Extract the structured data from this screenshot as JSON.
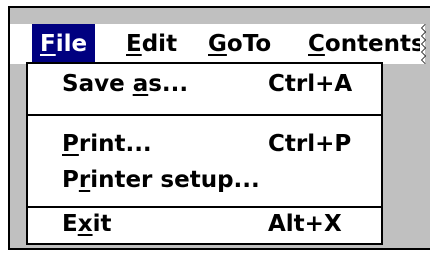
{
  "menubar": {
    "items": [
      {
        "pre": "",
        "accel": "F",
        "post": "ile",
        "active": true
      },
      {
        "pre": "",
        "accel": "E",
        "post": "dit",
        "active": false
      },
      {
        "pre": "",
        "accel": "G",
        "post": "oTo",
        "active": false
      },
      {
        "pre": "",
        "accel": "C",
        "post": "ontents",
        "active": false
      }
    ]
  },
  "file_menu": {
    "items": [
      {
        "pre": "Save ",
        "accel": "a",
        "post": "s...",
        "shortcut": "Ctrl+A"
      },
      {
        "pre": "",
        "accel": "P",
        "post": "rint...",
        "shortcut": "Ctrl+P"
      },
      {
        "pre": "P",
        "accel": "r",
        "post": "inter setup...",
        "shortcut": ""
      },
      {
        "pre": "E",
        "accel": "x",
        "post": "it",
        "shortcut": "Alt+X"
      }
    ]
  },
  "colors": {
    "highlight": "#000080",
    "workspace": "#c0c0c0",
    "menu_background": "#ffffff"
  }
}
